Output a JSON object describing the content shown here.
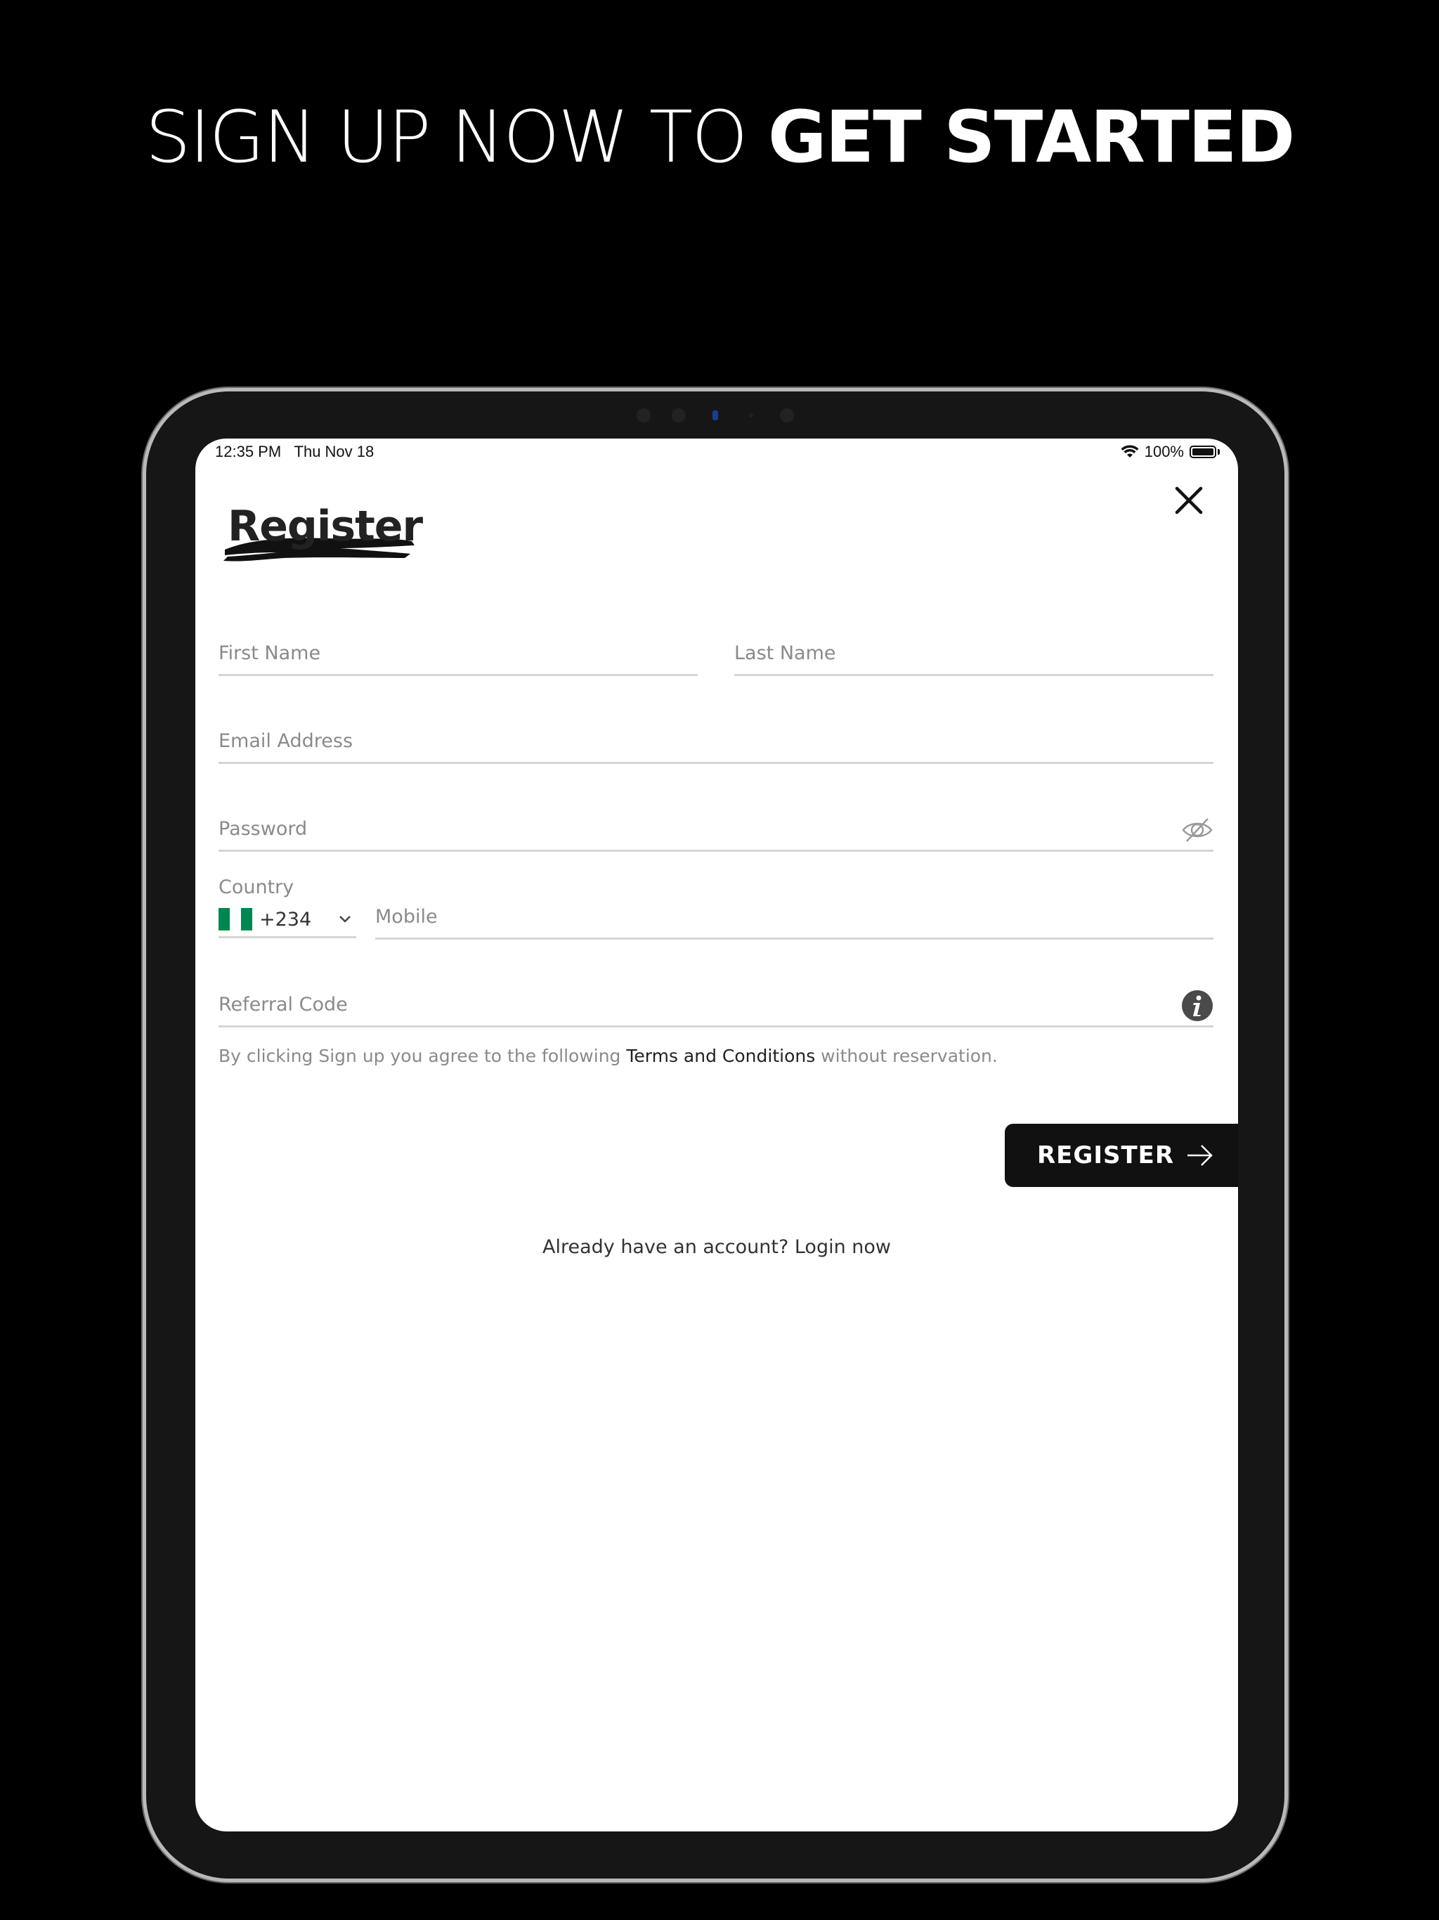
{
  "headline": {
    "light": "SIGN UP NOW TO ",
    "bold": "GET STARTED"
  },
  "status_bar": {
    "time": "12:35 PM",
    "date": "Thu Nov 18",
    "battery": "100%"
  },
  "form": {
    "title": "Register",
    "first_name": {
      "placeholder": "First Name",
      "value": ""
    },
    "last_name": {
      "placeholder": "Last Name",
      "value": ""
    },
    "email": {
      "placeholder": "Email Address",
      "value": ""
    },
    "password": {
      "placeholder": "Password",
      "value": ""
    },
    "country": {
      "label": "Country",
      "dial_code": "+234",
      "flag_colors": [
        "#008751",
        "#ffffff",
        "#008751"
      ]
    },
    "mobile": {
      "placeholder": "Mobile",
      "value": ""
    },
    "referral": {
      "placeholder": "Referral Code",
      "value": ""
    },
    "terms": {
      "prefix": "By clicking Sign up you agree to the following ",
      "link": "Terms and Conditions",
      "suffix": " without reservation."
    },
    "register_label": "REGISTER",
    "login_prompt": "Already have an account? Login now"
  },
  "icons": {
    "close": "close-icon",
    "password_toggle": "eye-slash-icon",
    "referral_info": "info-icon",
    "country_dropdown": "chevron-down-icon",
    "register_arrow": "arrow-right-icon"
  },
  "colors": {
    "background": "#000000",
    "button": "#111111",
    "device_frame": "#161616"
  }
}
